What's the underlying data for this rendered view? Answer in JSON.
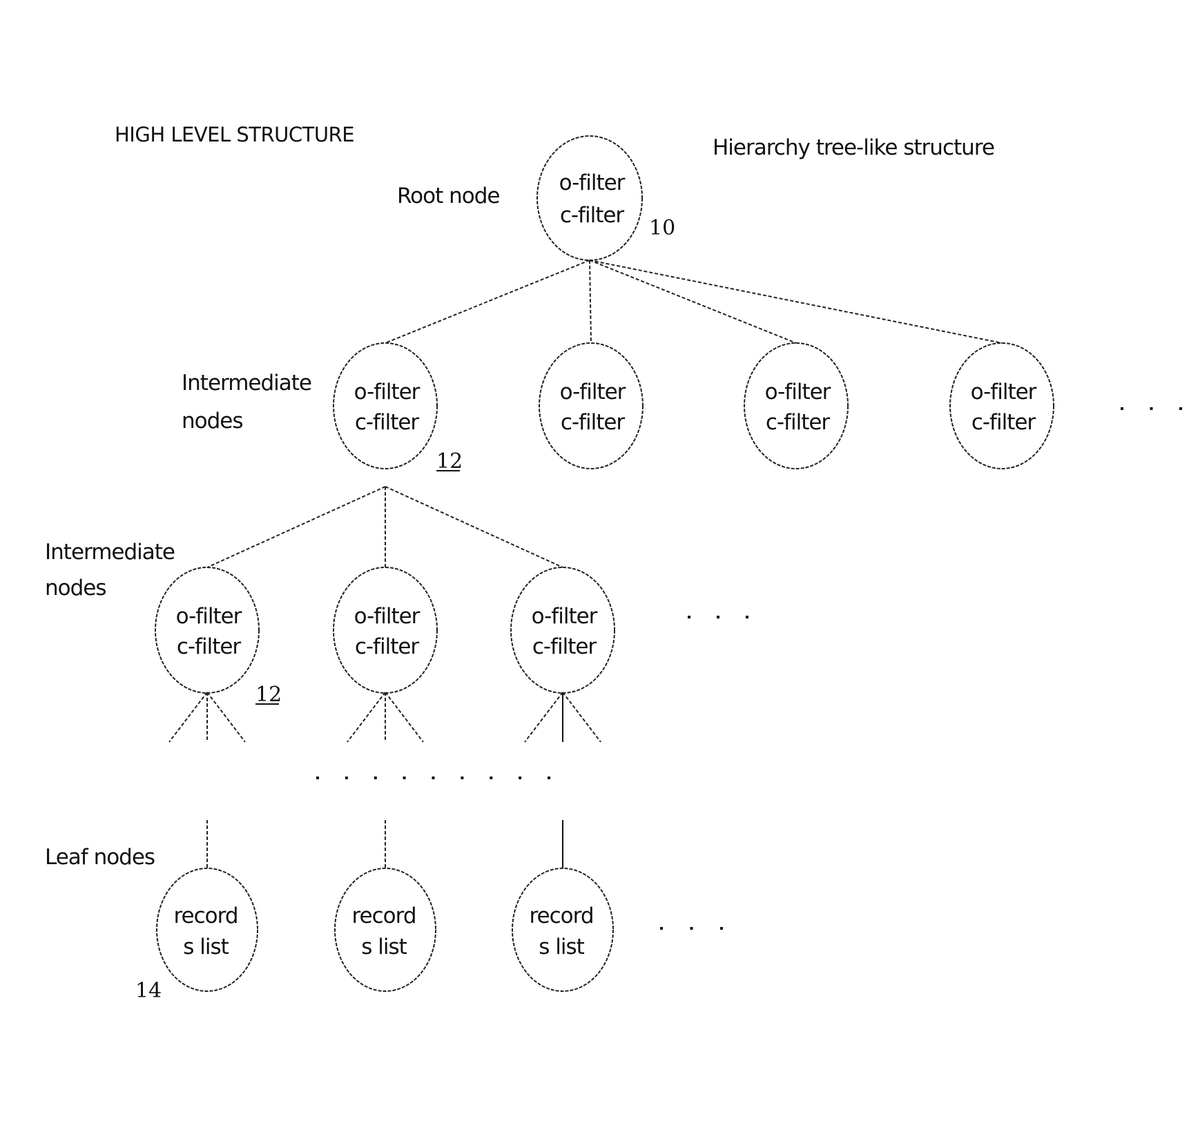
{
  "title": "HIGH LEVEL STRUCTURE",
  "subtitle": "Hierarchy tree-like structure",
  "labels": {
    "root": "Root node",
    "intermediate_1_line1": "Intermediate",
    "intermediate_1_line2": "nodes",
    "intermediate_2_line1": "Intermediate",
    "intermediate_2_line2": "nodes",
    "leaf": "Leaf nodes"
  },
  "reference_numbers": {
    "root": "10",
    "intermediate_1": "12",
    "intermediate_2": "12",
    "leaf": "14"
  },
  "root_node": {
    "line1": "o-filter",
    "line2": "c-filter"
  },
  "intermediate_level_1": [
    {
      "line1": "o-filter",
      "line2": "c-filter"
    },
    {
      "line1": "o-filter",
      "line2": "c-filter"
    },
    {
      "line1": "o-filter",
      "line2": "c-filter"
    },
    {
      "line1": "o-filter",
      "line2": "c-filter"
    }
  ],
  "intermediate_level_2": [
    {
      "line1": "o-filter",
      "line2": "c-filter"
    },
    {
      "line1": "o-filter",
      "line2": "c-filter"
    },
    {
      "line1": "o-filter",
      "line2": "c-filter"
    }
  ],
  "leaf_nodes": [
    {
      "line1": "record",
      "line2": "s list"
    },
    {
      "line1": "record",
      "line2": "s list"
    },
    {
      "line1": "record",
      "line2": "s list"
    }
  ],
  "ellipsis": {
    "level_1_more": "· · ·",
    "level_2_more": "· · ·",
    "leaf_more": "· · ·",
    "depth_continuation": "· · · · · · · · ·"
  }
}
